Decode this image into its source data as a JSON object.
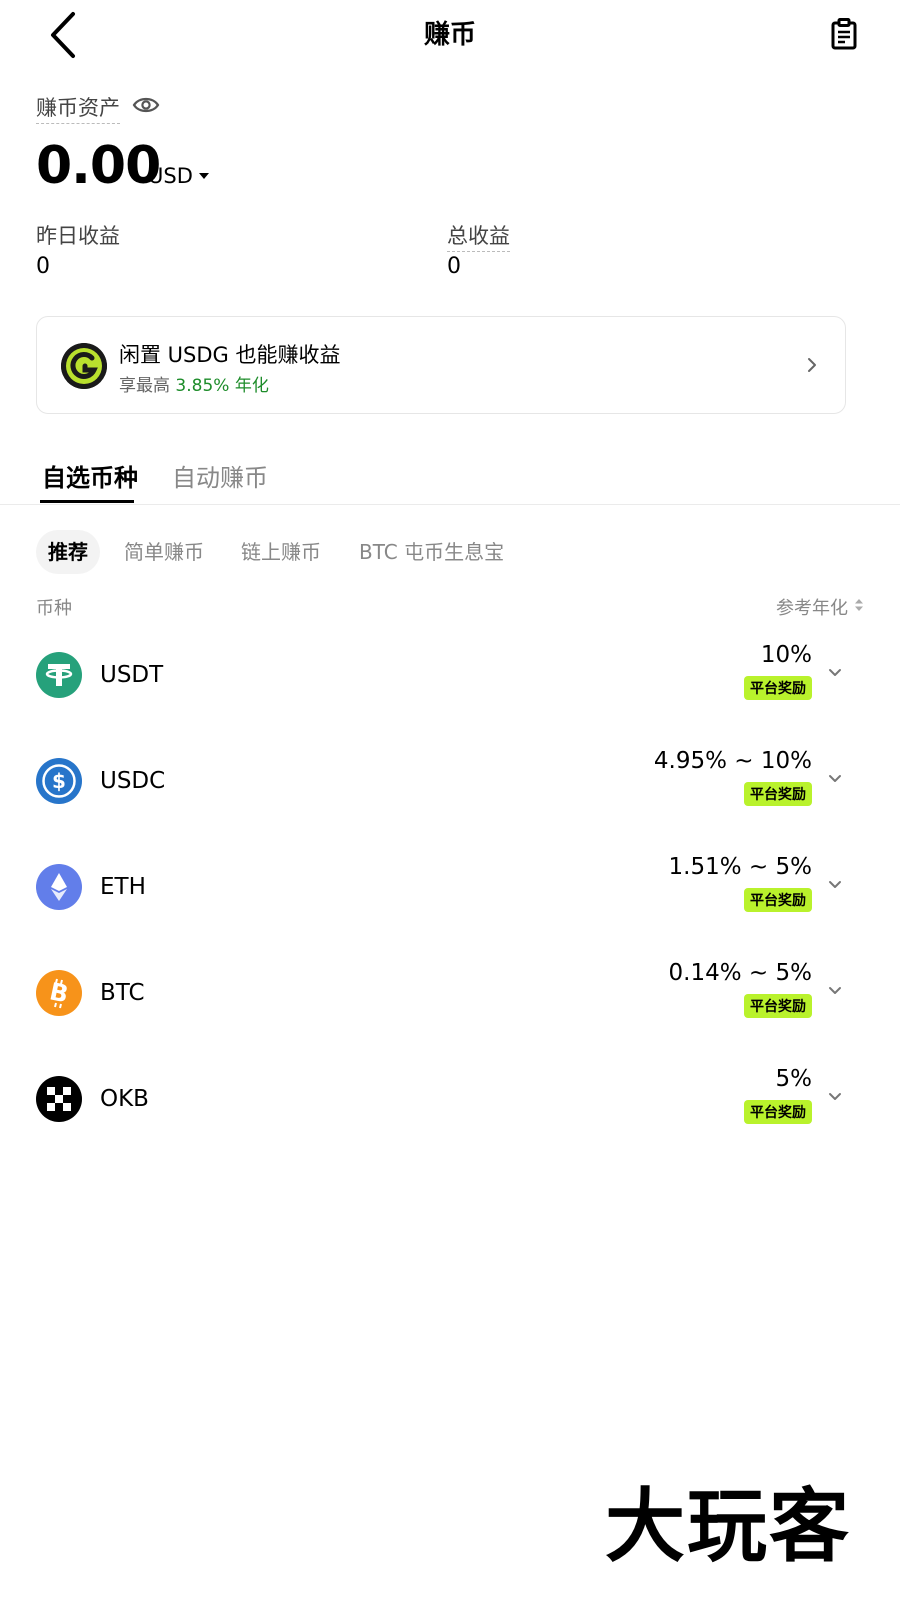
{
  "header": {
    "title": "赚币"
  },
  "assets": {
    "label": "赚币资产",
    "balance": "0.00",
    "currency": "USD",
    "yesterday_label": "昨日收益",
    "yesterday_value": "0",
    "total_label": "总收益",
    "total_value": "0"
  },
  "promo": {
    "title": "闲置 USDG 也能赚收益",
    "sub_prefix": "享最高",
    "sub_rate": "3.85%",
    "sub_suffix": "年化"
  },
  "tabs": [
    {
      "label": "自选币种",
      "active": true
    },
    {
      "label": "自动赚币",
      "active": false
    }
  ],
  "filters": [
    {
      "label": "推荐",
      "selected": true
    },
    {
      "label": "简单赚币",
      "selected": false
    },
    {
      "label": "链上赚币",
      "selected": false
    },
    {
      "label": "BTC 屯币生息宝",
      "selected": false
    }
  ],
  "list_header": {
    "coin": "币种",
    "apr": "参考年化"
  },
  "coins": [
    {
      "name": "USDT",
      "rate": "10%",
      "badge": "平台奖励",
      "color": "#26a17b"
    },
    {
      "name": "USDC",
      "rate": "4.95% ~ 10%",
      "badge": "平台奖励",
      "color": "#2775ca"
    },
    {
      "name": "ETH",
      "rate": "1.51% ~ 5%",
      "badge": "平台奖励",
      "color": "#627eea"
    },
    {
      "name": "BTC",
      "rate": "0.14% ~ 5%",
      "badge": "平台奖励",
      "color": "#f7931a"
    },
    {
      "name": "OKB",
      "rate": "5%",
      "badge": "平台奖励",
      "color": "#000000"
    }
  ],
  "watermark": "大玩客"
}
